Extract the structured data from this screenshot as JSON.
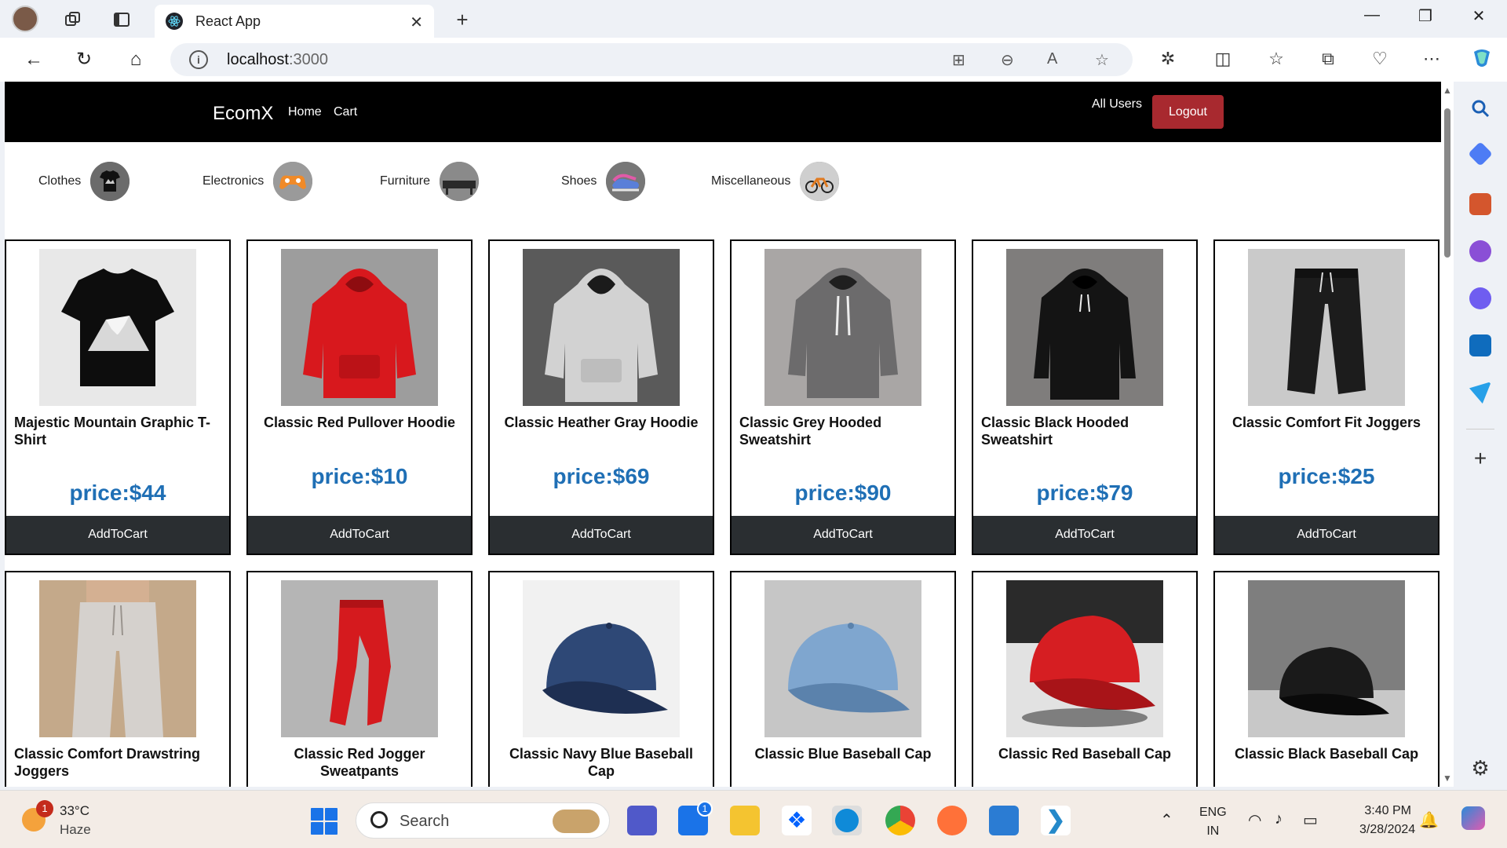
{
  "browser": {
    "tab_title": "React App",
    "url_host": "localhost",
    "url_port": ":3000"
  },
  "app": {
    "brand": "EcomX",
    "nav_home": "Home",
    "nav_cart": "Cart",
    "all_users": "All Users",
    "logout": "Logout",
    "add_to_cart_label": "AddToCart"
  },
  "categories": [
    {
      "label": "Clothes",
      "icon": "tshirt-thumb"
    },
    {
      "label": "Electronics",
      "icon": "gamepad-thumb"
    },
    {
      "label": "Furniture",
      "icon": "console-table-thumb"
    },
    {
      "label": "Shoes",
      "icon": "sneakers-thumb"
    },
    {
      "label": "Miscellaneous",
      "icon": "bicycle-thumb"
    }
  ],
  "products": [
    {
      "title": "Majestic Mountain Graphic T-Shirt",
      "price": "price:$44",
      "image": "black-mountain-tshirt"
    },
    {
      "title": "Classic Red Pullover Hoodie",
      "price": "price:$10",
      "image": "red-hoodie"
    },
    {
      "title": "Classic Heather Gray Hoodie",
      "price": "price:$69",
      "image": "heather-gray-hoodie"
    },
    {
      "title": "Classic Grey Hooded Sweatshirt",
      "price": "price:$90",
      "image": "grey-hooded-sweatshirt"
    },
    {
      "title": "Classic Black Hooded Sweatshirt",
      "price": "price:$79",
      "image": "black-hooded-sweatshirt"
    },
    {
      "title": "Classic Comfort Fit Joggers",
      "price": "price:$25",
      "image": "black-joggers"
    },
    {
      "title": "Classic Comfort Drawstring Joggers",
      "image": "light-gray-joggers"
    },
    {
      "title": "Classic Red Jogger Sweatpants",
      "image": "red-joggers"
    },
    {
      "title": "Classic Navy Blue Baseball Cap",
      "image": "navy-cap"
    },
    {
      "title": "Classic Blue Baseball Cap",
      "image": "light-blue-cap"
    },
    {
      "title": "Classic Red Baseball Cap",
      "image": "red-cap"
    },
    {
      "title": "Classic Black Baseball Cap",
      "image": "black-cap"
    }
  ],
  "taskbar": {
    "weather_badge": "1",
    "weather_temp": "33°C",
    "weather_cond": "Haze",
    "search_label": "Search",
    "mail_badge": "1",
    "lang_line1": "ENG",
    "lang_line2": "IN",
    "time": "3:40 PM",
    "date": "3/28/2024"
  },
  "colors": {
    "navbar_bg": "#000000",
    "logout_bg": "#a8292f",
    "price_text": "#1f6fb5",
    "cart_button_bg": "#2a2e31"
  }
}
